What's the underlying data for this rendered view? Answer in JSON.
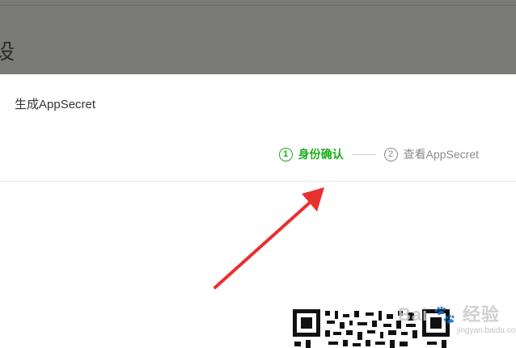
{
  "backdrop": {
    "partial_text": "设"
  },
  "dialog": {
    "title": "生成AppSecret"
  },
  "steps": [
    {
      "number": "1",
      "label": "身份确认",
      "state": "active"
    },
    {
      "number": "2",
      "label": "查看AppSecret",
      "state": "inactive"
    }
  ],
  "colors": {
    "accent": "#1aad19",
    "arrow": "#e8302f",
    "overlay": "#7a7a79"
  },
  "watermark": {
    "brand": "Bai",
    "word": "经验",
    "sub": "jingyan.baidu.com"
  }
}
